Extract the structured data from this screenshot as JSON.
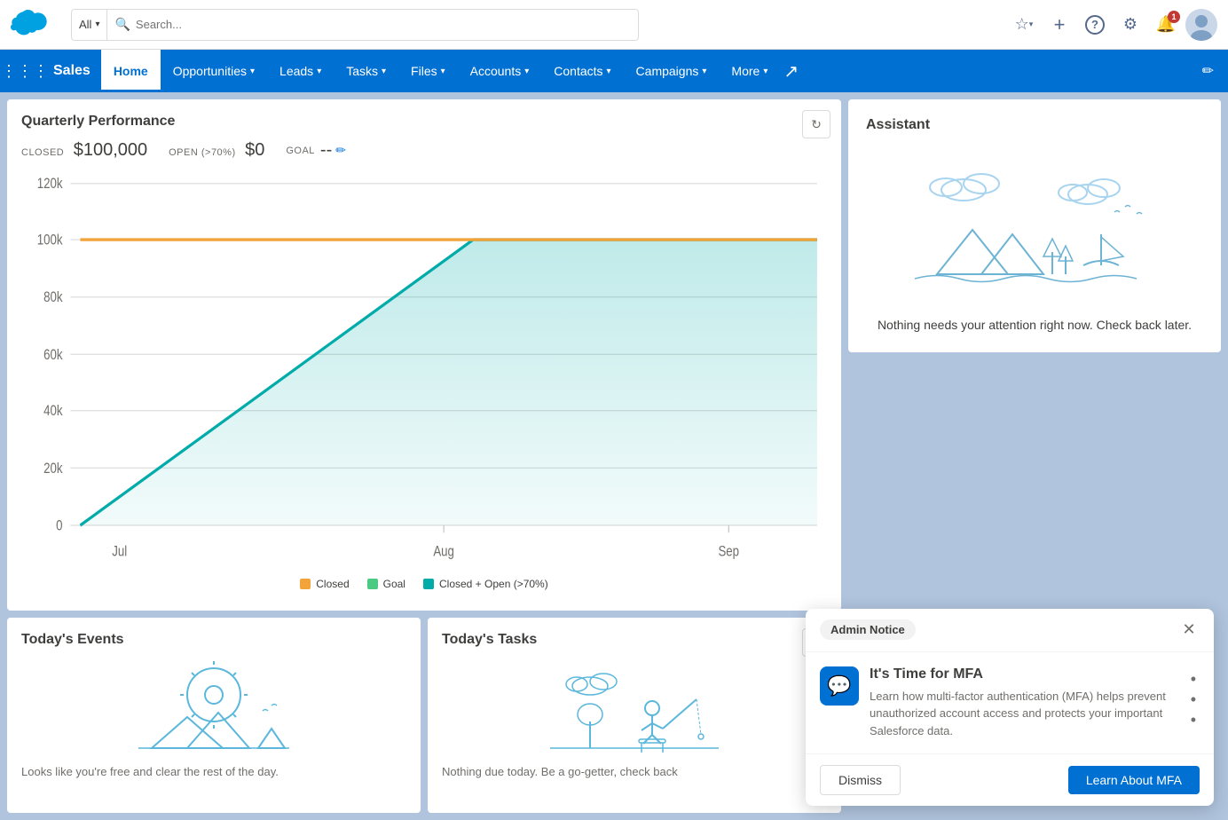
{
  "topbar": {
    "search_placeholder": "Search...",
    "search_scope": "All",
    "icons": {
      "bookmark": "☆",
      "add": "+",
      "bell": "🔔",
      "help": "?",
      "settings": "⚙",
      "notification_count": "1"
    }
  },
  "navbar": {
    "app_name": "Sales",
    "items": [
      {
        "label": "Home",
        "active": true,
        "has_chevron": false
      },
      {
        "label": "Opportunities",
        "active": false,
        "has_chevron": true
      },
      {
        "label": "Leads",
        "active": false,
        "has_chevron": true
      },
      {
        "label": "Tasks",
        "active": false,
        "has_chevron": true
      },
      {
        "label": "Files",
        "active": false,
        "has_chevron": true
      },
      {
        "label": "Accounts",
        "active": false,
        "has_chevron": true
      },
      {
        "label": "Contacts",
        "active": false,
        "has_chevron": true
      },
      {
        "label": "Campaigns",
        "active": false,
        "has_chevron": true
      },
      {
        "label": "More",
        "active": false,
        "has_chevron": true
      }
    ],
    "edit_icon": "✏"
  },
  "chart": {
    "title": "Quarterly Performance",
    "closed_label": "CLOSED",
    "closed_value": "$100,000",
    "open_label": "OPEN (>70%)",
    "open_value": "$0",
    "goal_label": "GOAL",
    "goal_value": "--",
    "y_labels": [
      "120k",
      "100k",
      "80k",
      "60k",
      "40k",
      "20k",
      "0"
    ],
    "x_labels": [
      "Jul",
      "Aug",
      "Sep"
    ],
    "legend": [
      {
        "color": "#f2a33a",
        "label": "Closed"
      },
      {
        "color": "#4bca81",
        "label": "Goal"
      },
      {
        "color": "#00aba9",
        "label": "Closed + Open (>70%)"
      }
    ]
  },
  "assistant": {
    "title": "Assistant",
    "message": "Nothing needs your attention right now. Check back later."
  },
  "today_events": {
    "title": "Today's Events",
    "body_text": "Looks like you're free and clear the rest of the day."
  },
  "today_tasks": {
    "title": "Today's Tasks",
    "body_text": "Nothing due today. Be a go-getter, check back"
  },
  "admin_notice": {
    "badge": "Admin Notice",
    "title": "It's Time for MFA",
    "body": "Learn how multi-factor authentication (MFA) helps prevent unauthorized account access and protects your important Salesforce data.",
    "dismiss_label": "Dismiss",
    "learn_label": "Learn About MFA"
  }
}
